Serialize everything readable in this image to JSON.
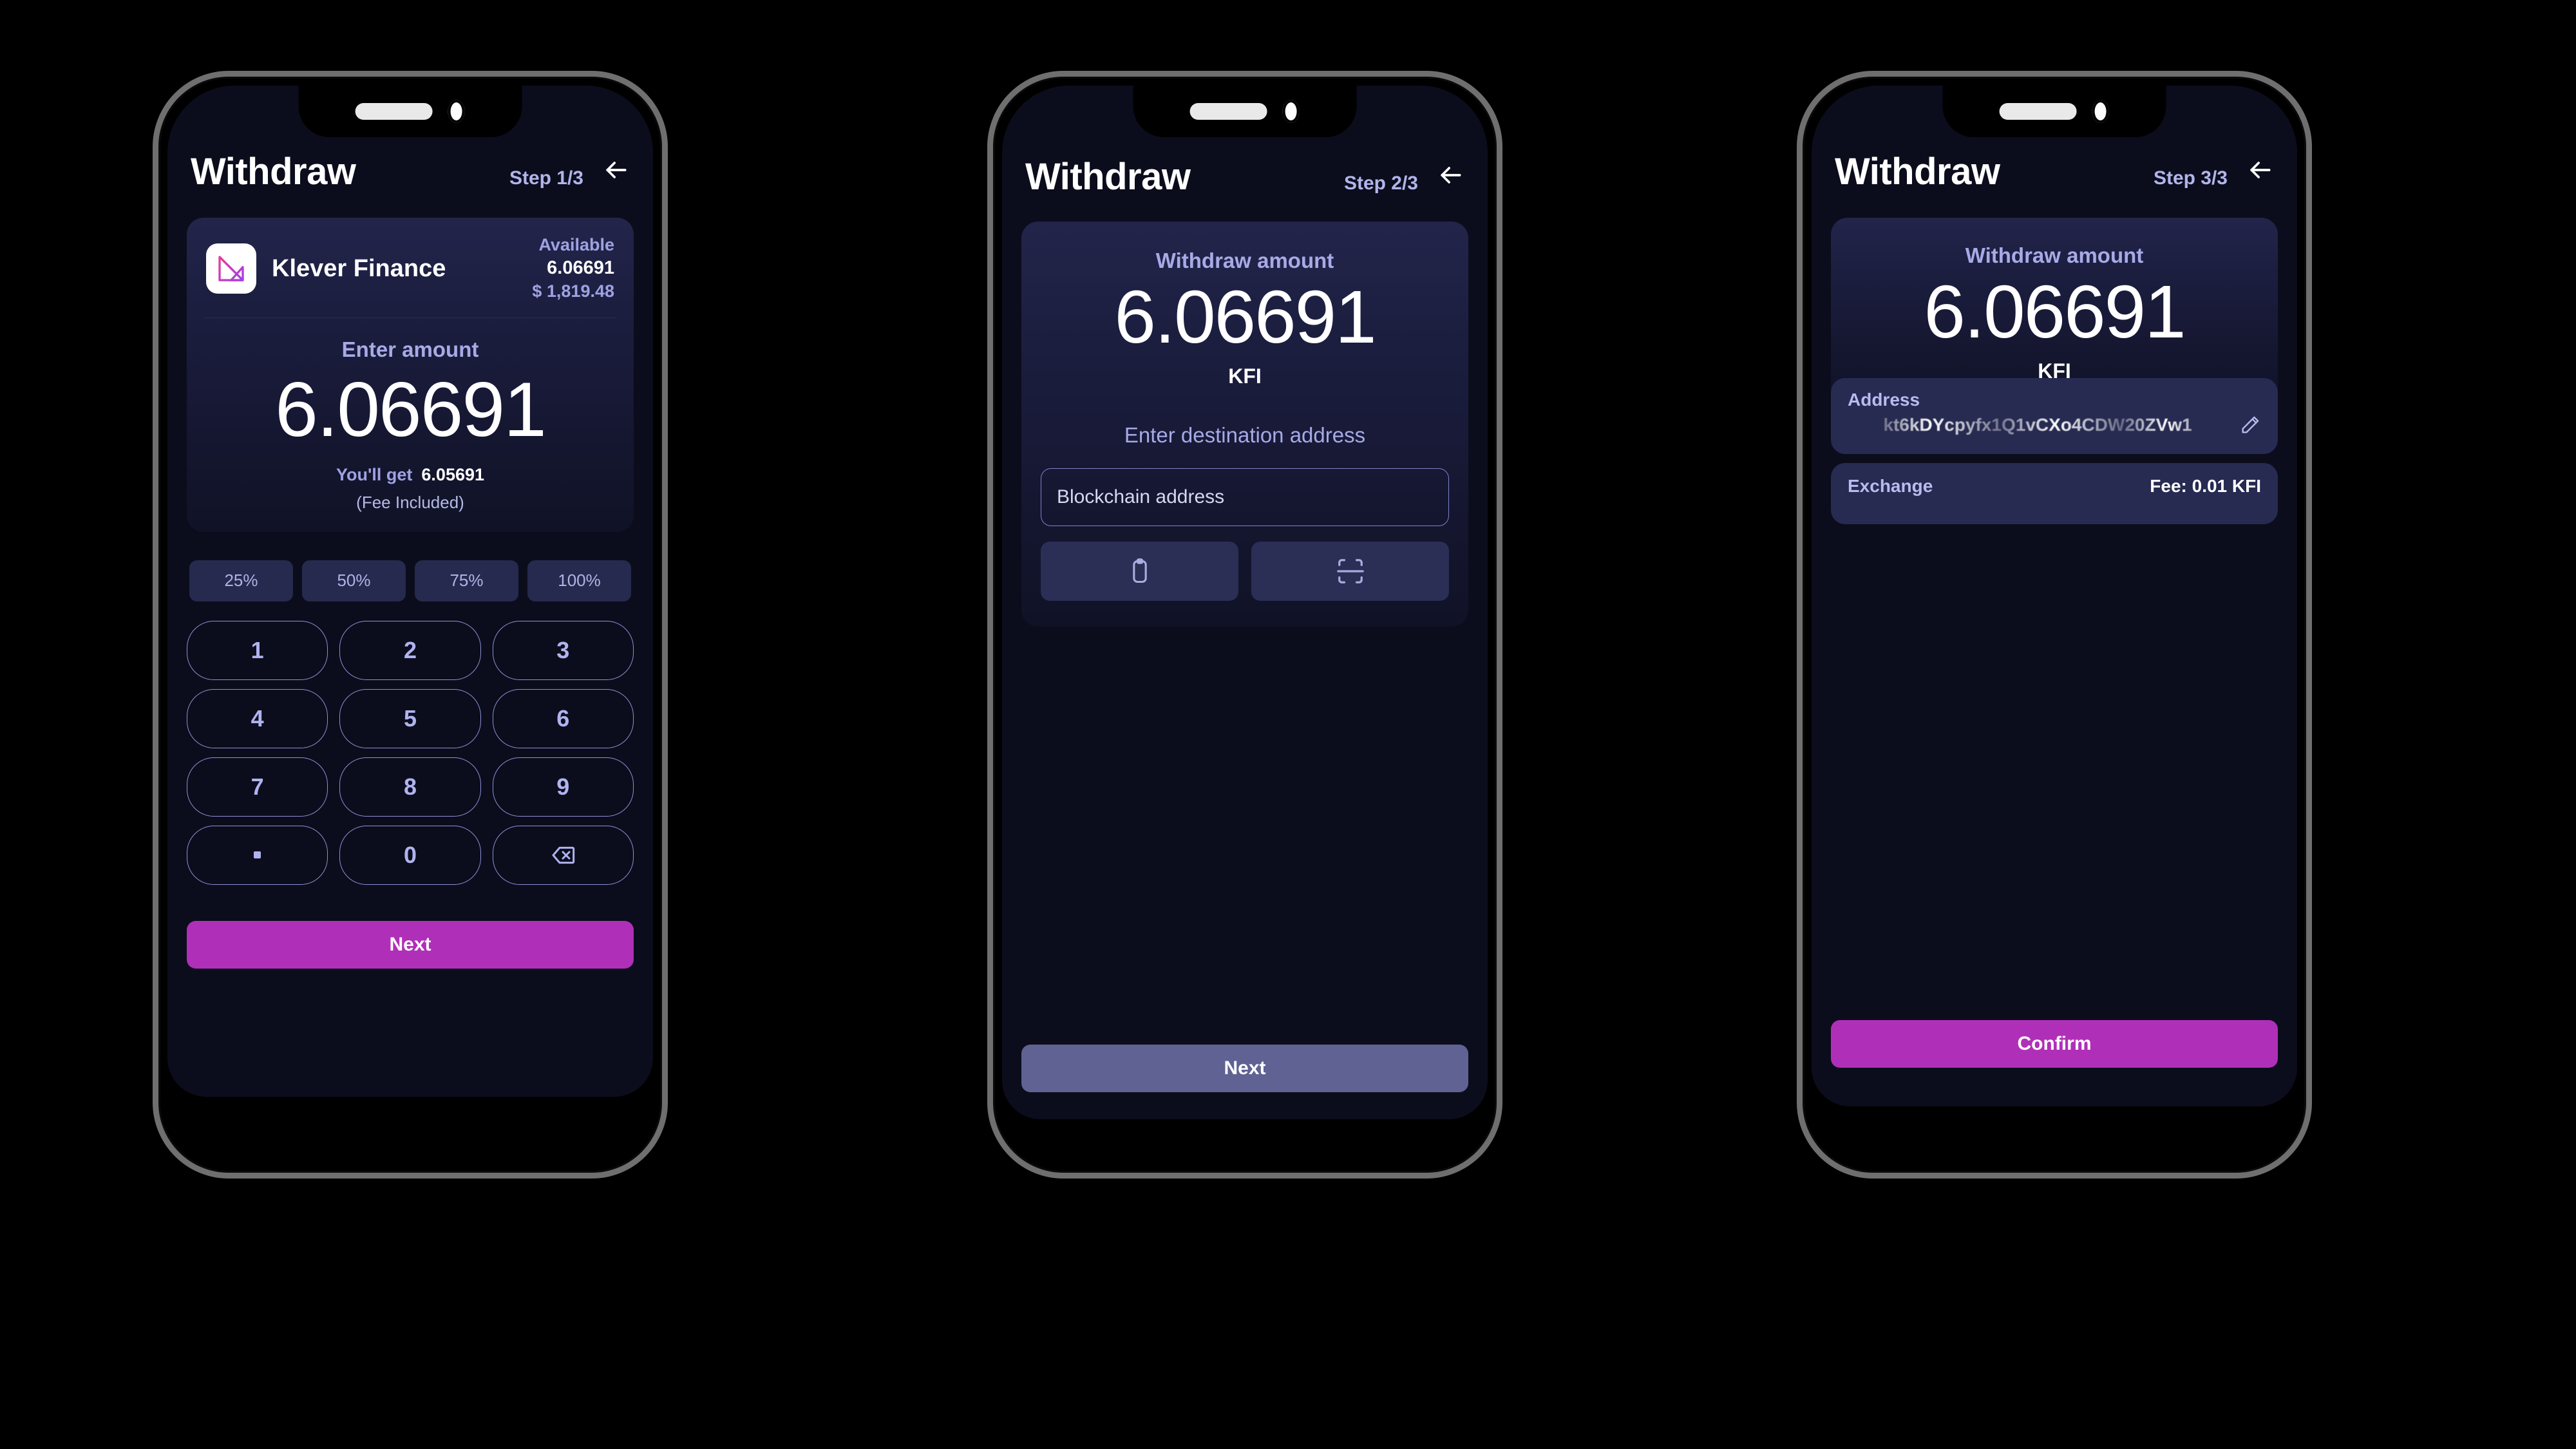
{
  "brand": {
    "accent_magenta": "#b02fb8",
    "accent_periwinkle": "#a7aae6",
    "screen_bg": "#0b0d1c",
    "card_bg": "#22244a",
    "muted_button": "#5f6292"
  },
  "screens": [
    {
      "id": "step1",
      "header": {
        "title": "Withdraw",
        "step": "Step 1/3",
        "back_icon": "arrow-left-icon"
      },
      "asset": {
        "logo_icon": "klever-logo-icon",
        "name": "Klever Finance",
        "available_label": "Available",
        "available_amount": "6.06691",
        "available_usd": "$ 1,819.48"
      },
      "amount": {
        "label": "Enter amount",
        "value": "6.06691",
        "youll_get_label": "You'll get",
        "youll_get_value": "6.05691",
        "fee_note": "(Fee Included)"
      },
      "percent_buttons": [
        "25%",
        "50%",
        "75%",
        "100%"
      ],
      "keypad": [
        "1",
        "2",
        "3",
        "4",
        "5",
        "6",
        "7",
        "8",
        "9",
        ".",
        "0",
        "backspace-icon"
      ],
      "primary_button": "Next"
    },
    {
      "id": "step2",
      "header": {
        "title": "Withdraw",
        "step": "Step 2/3",
        "back_icon": "arrow-left-icon"
      },
      "amount": {
        "label": "Withdraw amount",
        "value": "6.06691",
        "ticker": "KFI"
      },
      "destination": {
        "label": "Enter destination address",
        "input_placeholder": "Blockchain address",
        "input_value": "",
        "paste_icon": "clipboard-icon",
        "scan_icon": "qr-scan-icon"
      },
      "primary_button": "Next"
    },
    {
      "id": "step3",
      "header": {
        "title": "Withdraw",
        "step": "Step 3/3",
        "back_icon": "arrow-left-icon"
      },
      "amount": {
        "label": "Withdraw amount",
        "value": "6.06691",
        "ticker": "KFI"
      },
      "address_card": {
        "label": "Address",
        "value": "kt6kDYcpyfx1Q1vCXo4CDW20ZVw1",
        "edit_icon": "pencil-icon"
      },
      "exchange_card": {
        "label": "Exchange",
        "fee": "Fee:  0.01  KFI"
      },
      "primary_button": "Confirm"
    }
  ]
}
